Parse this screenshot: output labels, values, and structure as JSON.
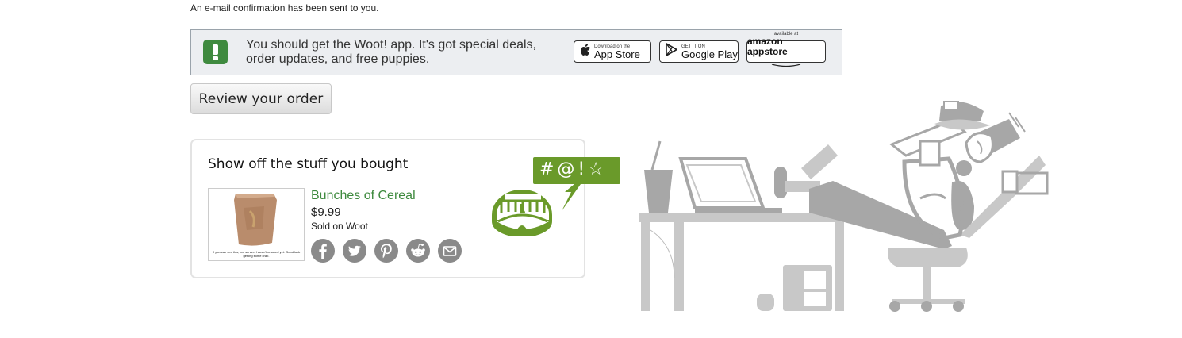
{
  "confirmation_text": "An e-mail confirmation has been sent to you.",
  "app_banner": {
    "line1": "You should get the Woot! app. It's got special deals,",
    "line2": "order updates, and free puppies.",
    "stores": [
      {
        "small": "Download on the",
        "big": "App Store",
        "icon": "apple-icon"
      },
      {
        "small": "GET IT ON",
        "big": "Google Play",
        "icon": "google-play-icon"
      },
      {
        "small": "available at",
        "big": "amazon appstore",
        "icon": "amazon-icon"
      }
    ]
  },
  "review_button": "Review your order",
  "show_off": {
    "title": "Show off the stuff you bought",
    "product": {
      "name": "Bunches of Cereal",
      "price": "$9.99",
      "sold_by": "Sold on Woot",
      "image_caption": "If you can see this, our servers haven't crashed yet. Good luck getting some crap."
    },
    "share_icons": [
      "facebook-icon",
      "twitter-icon",
      "pinterest-icon",
      "reddit-icon",
      "email-icon"
    ],
    "speech_symbols": "#@!☆"
  },
  "colors": {
    "green": "#3e8a3e",
    "mascot_green": "#6a9a2a",
    "icon_gray": "#8a8a8a",
    "illustration_gray": "#a7a7a7"
  }
}
